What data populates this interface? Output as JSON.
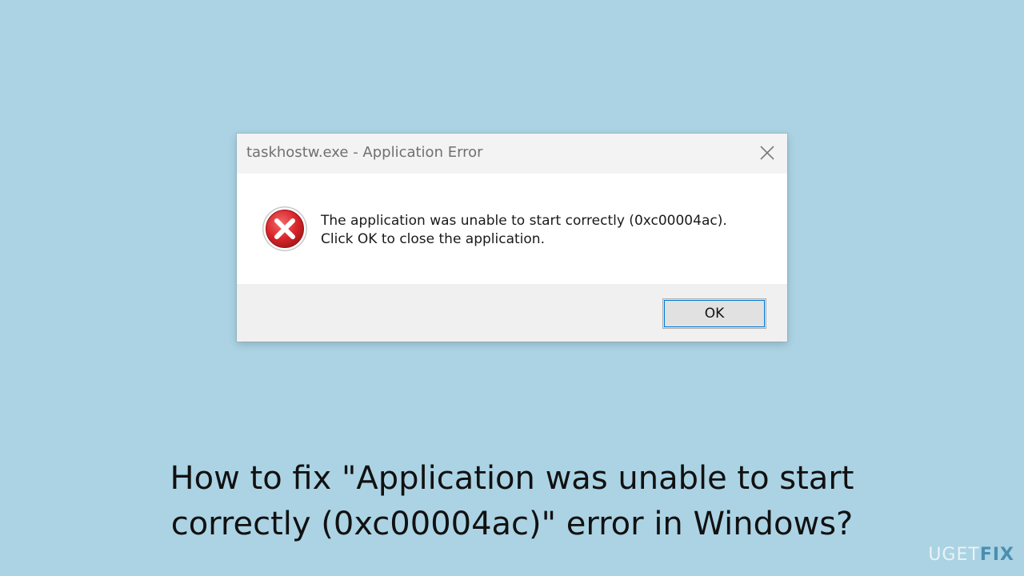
{
  "colors": {
    "background": "#abd3e4",
    "titlebar": "#f3f3f3",
    "footer": "#f0f0f0",
    "error_red": "#d9252a",
    "focus_blue": "#0078d7",
    "logo_accent": "#4a8fb0"
  },
  "dialog": {
    "title": "taskhostw.exe - Application Error",
    "close_icon": "close-icon",
    "icon": "error-icon",
    "message_line1": "The application was unable to start correctly (0xc00004ac).",
    "message_line2": "Click OK to close the application.",
    "ok_label": "OK"
  },
  "headline": {
    "line1": "How to fix \"Application was unable to start",
    "line2": "correctly (0xc00004ac)\" error in Windows?"
  },
  "logo": {
    "part1": "UG",
    "part2": "ET",
    "part3": "FIX"
  }
}
